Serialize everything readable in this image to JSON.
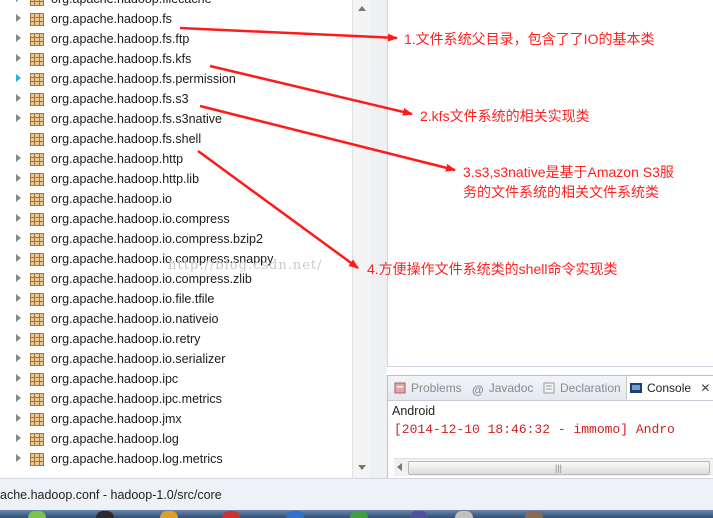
{
  "tree": {
    "rows": [
      {
        "label": "org.apache.hadoop.filecache",
        "expand": "closed"
      },
      {
        "label": "org.apache.hadoop.fs",
        "expand": "closed"
      },
      {
        "label": "org.apache.hadoop.fs.ftp",
        "expand": "closed"
      },
      {
        "label": "org.apache.hadoop.fs.kfs",
        "expand": "closed"
      },
      {
        "label": "org.apache.hadoop.fs.permission",
        "expand": "open"
      },
      {
        "label": "org.apache.hadoop.fs.s3",
        "expand": "closed"
      },
      {
        "label": "org.apache.hadoop.fs.s3native",
        "expand": "closed"
      },
      {
        "label": "org.apache.hadoop.fs.shell",
        "expand": "none"
      },
      {
        "label": "org.apache.hadoop.http",
        "expand": "closed"
      },
      {
        "label": "org.apache.hadoop.http.lib",
        "expand": "closed"
      },
      {
        "label": "org.apache.hadoop.io",
        "expand": "closed"
      },
      {
        "label": "org.apache.hadoop.io.compress",
        "expand": "closed"
      },
      {
        "label": "org.apache.hadoop.io.compress.bzip2",
        "expand": "closed"
      },
      {
        "label": "org.apache.hadoop.io.compress.snappy",
        "expand": "closed"
      },
      {
        "label": "org.apache.hadoop.io.compress.zlib",
        "expand": "closed"
      },
      {
        "label": "org.apache.hadoop.io.file.tfile",
        "expand": "closed"
      },
      {
        "label": "org.apache.hadoop.io.nativeio",
        "expand": "closed"
      },
      {
        "label": "org.apache.hadoop.io.retry",
        "expand": "closed"
      },
      {
        "label": "org.apache.hadoop.io.serializer",
        "expand": "closed"
      },
      {
        "label": "org.apache.hadoop.ipc",
        "expand": "closed"
      },
      {
        "label": "org.apache.hadoop.ipc.metrics",
        "expand": "closed"
      },
      {
        "label": "org.apache.hadoop.jmx",
        "expand": "closed"
      },
      {
        "label": "org.apache.hadoop.log",
        "expand": "closed"
      },
      {
        "label": "org.apache.hadoop.log.metrics",
        "expand": "closed"
      }
    ]
  },
  "annotations": {
    "note1": "1.文件系统父目录，包含了了IO的基本类",
    "note2": "2.kfs文件系统的相关实现类",
    "note3_line1": "3.s3,s3native是基于Amazon S3服",
    "note3_line2": "务的文件系统的相关文件系统类",
    "note4": "4.方便操作文件系统类的shell命令实现类",
    "watermark": "http://blog.csdn.net/"
  },
  "console": {
    "tabs": {
      "problems": "Problems",
      "javadoc": "Javadoc",
      "declaration": "Declaration",
      "console": "Console"
    },
    "title": "Android",
    "line": "[2014-12-10 18:46:32 - immomo] Andro"
  },
  "status": {
    "text": "ache.hadoop.conf - hadoop-1.0/src/core"
  },
  "colors": {
    "annotation": "#ff2020",
    "console_error": "#d02020",
    "package_icon": "#b8864b"
  }
}
